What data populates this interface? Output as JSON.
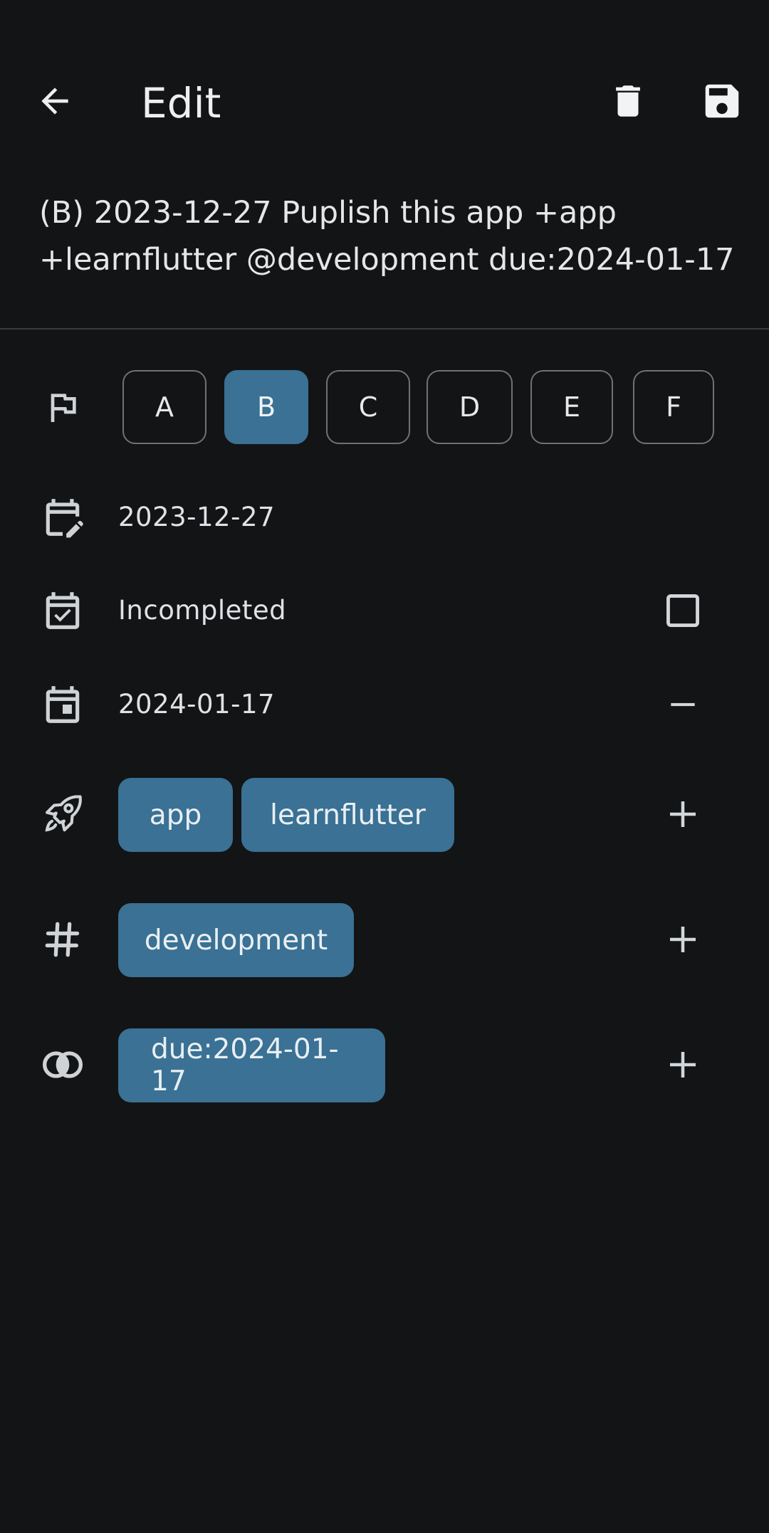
{
  "header": {
    "title": "Edit",
    "back_icon": "arrow-back-icon",
    "delete_icon": "trash-icon",
    "save_icon": "save-icon"
  },
  "todo": {
    "raw_line1": "(B) 2023-12-27 Puplish this app +app",
    "raw_line2": "+learnflutter @development due:2024-01-17"
  },
  "priority": {
    "icon": "flag-icon",
    "options": [
      "A",
      "B",
      "C",
      "D",
      "E",
      "F"
    ],
    "selected": "B"
  },
  "creation_date": {
    "icon": "calendar-edit-icon",
    "value": "2023-12-27"
  },
  "completion": {
    "icon": "calendar-check-icon",
    "status": "Incompleted",
    "checked": false
  },
  "due_date": {
    "icon": "calendar-today-icon",
    "value": "2024-01-17",
    "action_icon": "minus-icon"
  },
  "projects": {
    "icon": "rocket-icon",
    "items": [
      "app",
      "learnflutter"
    ],
    "action_icon": "plus-icon"
  },
  "contexts": {
    "icon": "hashtag-icon",
    "items": [
      "development"
    ],
    "action_icon": "plus-icon"
  },
  "key_values": {
    "icon": "rings-icon",
    "items": [
      "due:2024-01-17"
    ],
    "action_icon": "plus-icon"
  },
  "colors": {
    "background": "#131416",
    "accent": "#3a7194",
    "text": "#e6e8ea",
    "outline": "#6e7276"
  }
}
